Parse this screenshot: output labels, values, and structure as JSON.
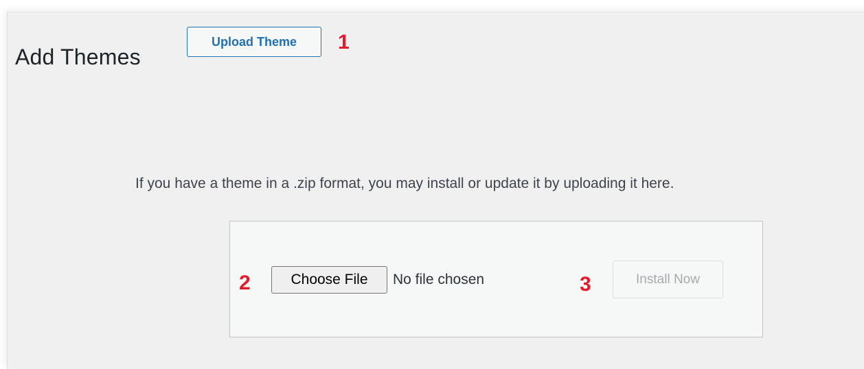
{
  "header": {
    "title": "Add Themes",
    "upload_button_label": "Upload Theme"
  },
  "annotations": {
    "marker_1": "1",
    "marker_2": "2",
    "marker_3": "3"
  },
  "upload": {
    "description": "If you have a theme in a .zip format, you may install or update it by uploading it here.",
    "choose_file_label": "Choose File",
    "no_file_text": "No file chosen",
    "install_button_label": "Install Now",
    "install_disabled": true
  },
  "colors": {
    "accent": "#2271b1",
    "marker_red": "#e31b2c",
    "background": "#f0f0f1"
  }
}
